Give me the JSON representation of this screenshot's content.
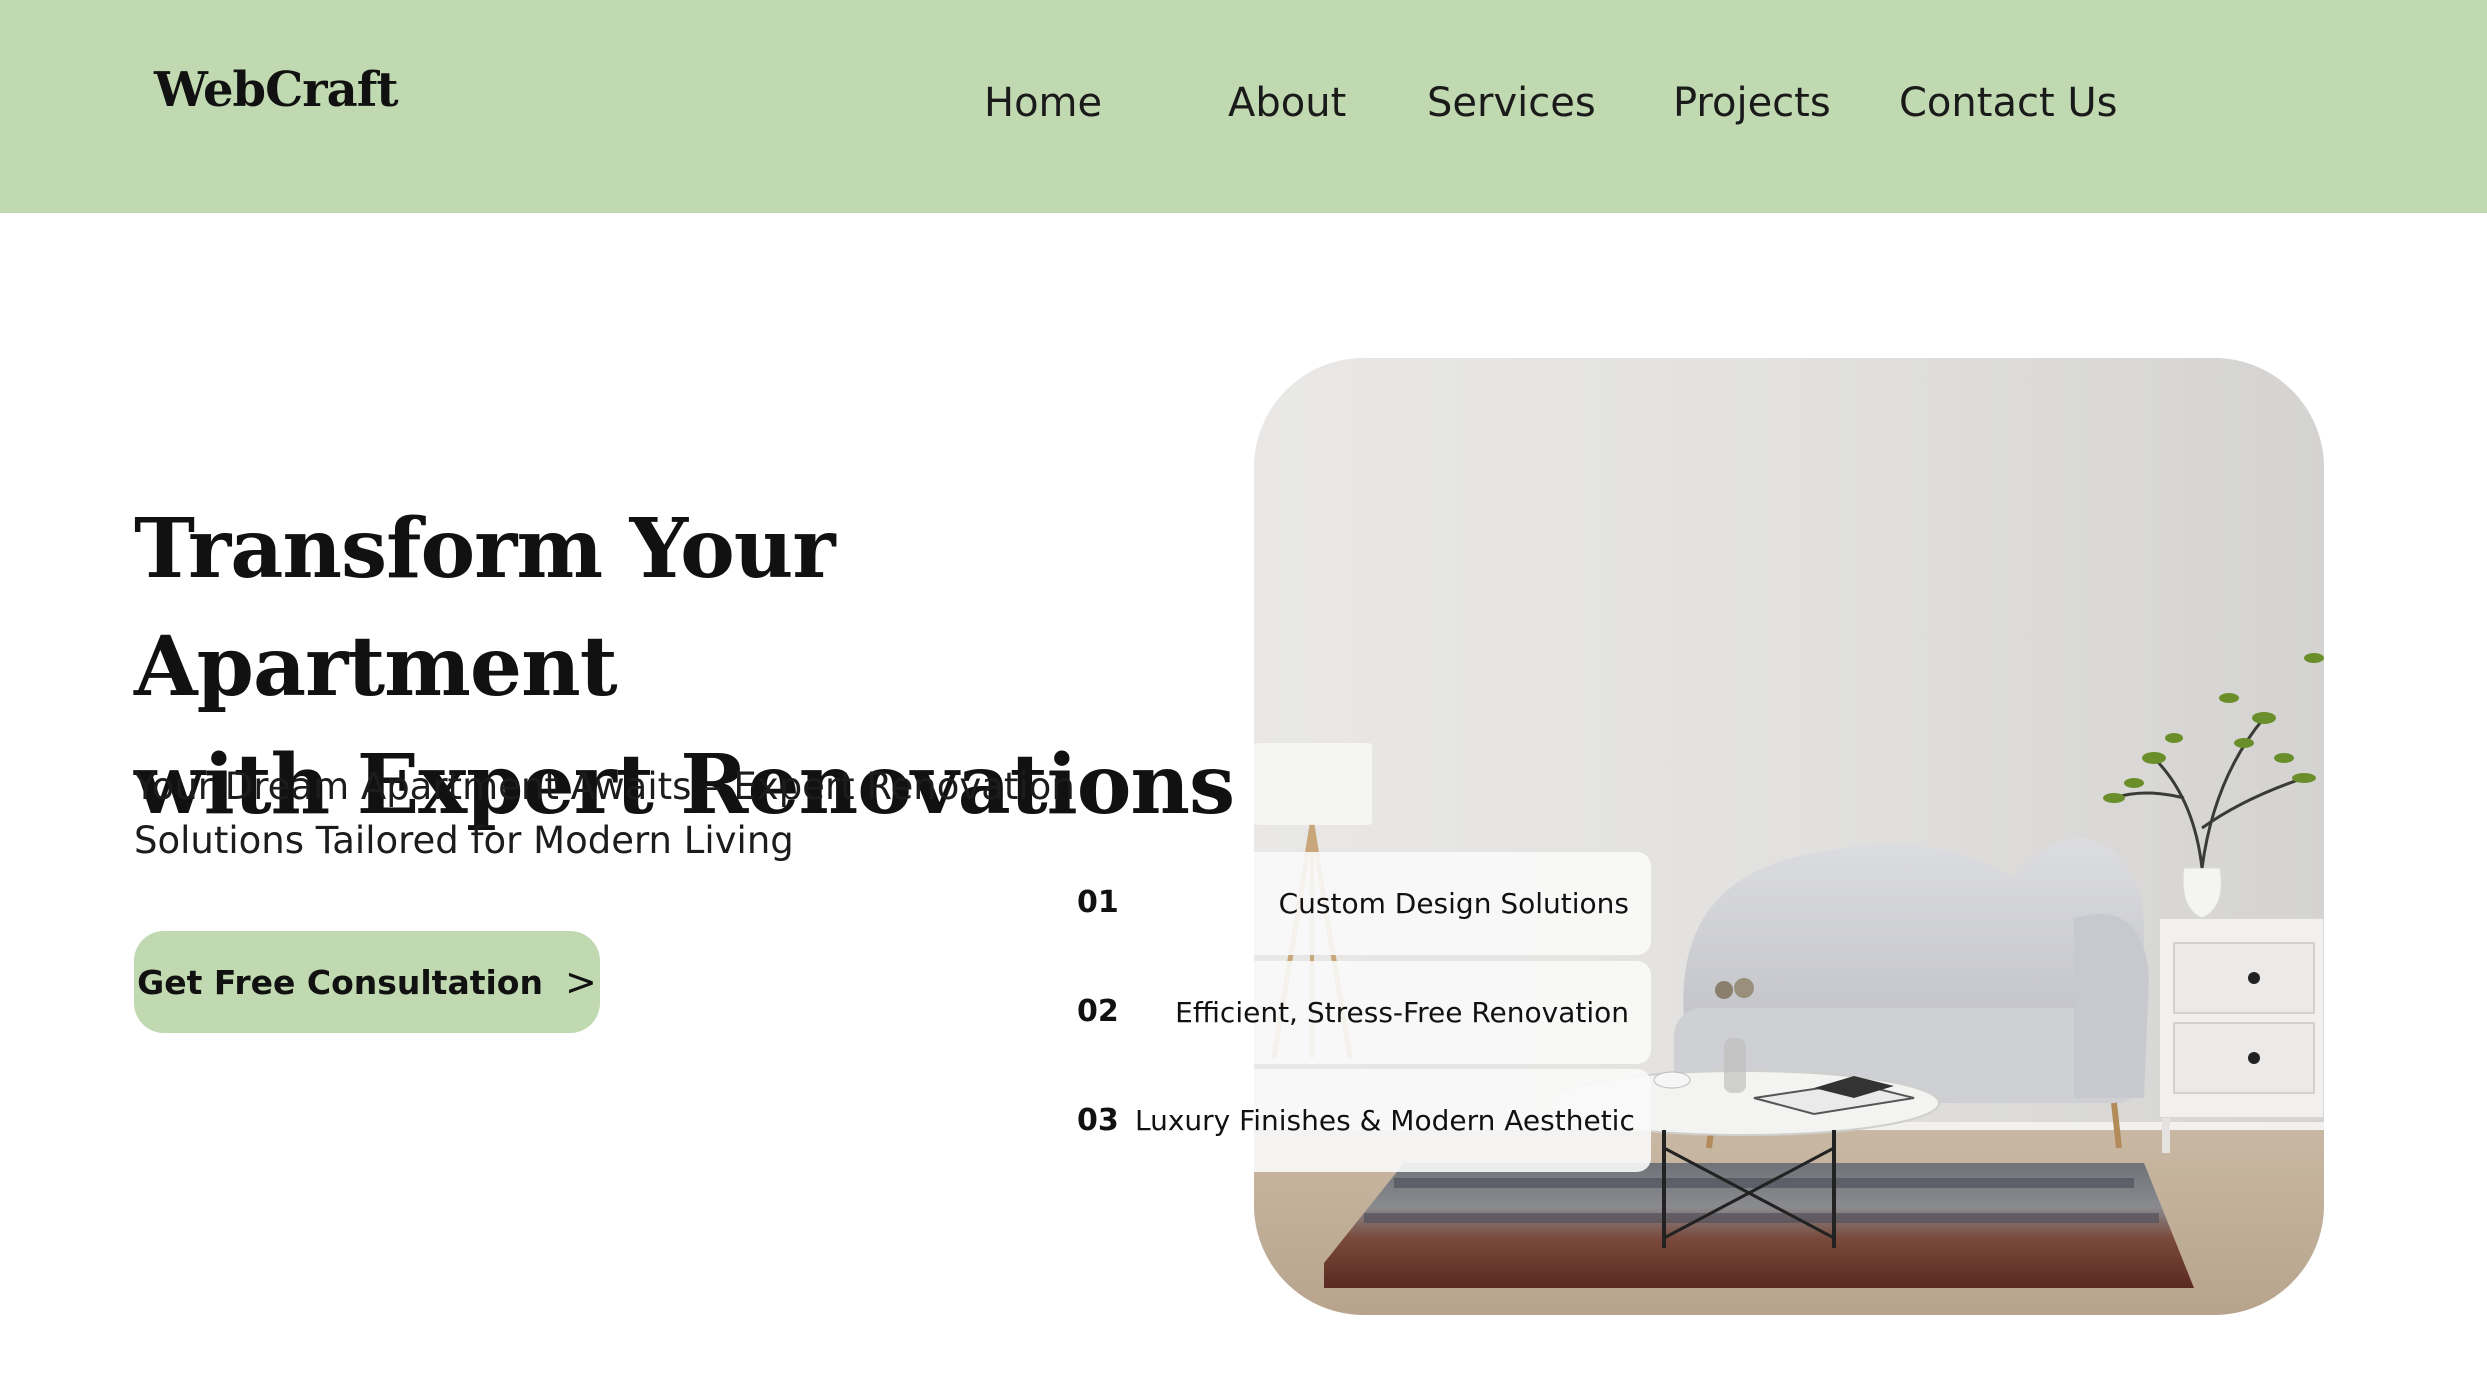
{
  "header": {
    "logo": "WebCraft",
    "nav": [
      "Home",
      "About",
      "Services",
      "Projects",
      "Contact Us"
    ]
  },
  "hero": {
    "title_line1": "Transform Your Apartment",
    "title_line2": "with Expert Renovations",
    "subtitle_line1": "Your Dream Apartment Awaits – Expert Renovation",
    "subtitle_line2": "Solutions Tailored for Modern Living",
    "cta_label": "Get Free Consultation",
    "cta_chevron": ">"
  },
  "features": [
    {
      "num": "01",
      "label": "Custom Design Solutions"
    },
    {
      "num": "02",
      "label": "Efficient, Stress-Free Renovation"
    },
    {
      "num": "03",
      "label": "Luxury Finishes & Modern Aesthetic"
    }
  ],
  "colors": {
    "accent": "#c0d9b0",
    "text": "#111111",
    "background": "#ffffff"
  },
  "icons": {
    "cta": "chevron-right-icon"
  }
}
